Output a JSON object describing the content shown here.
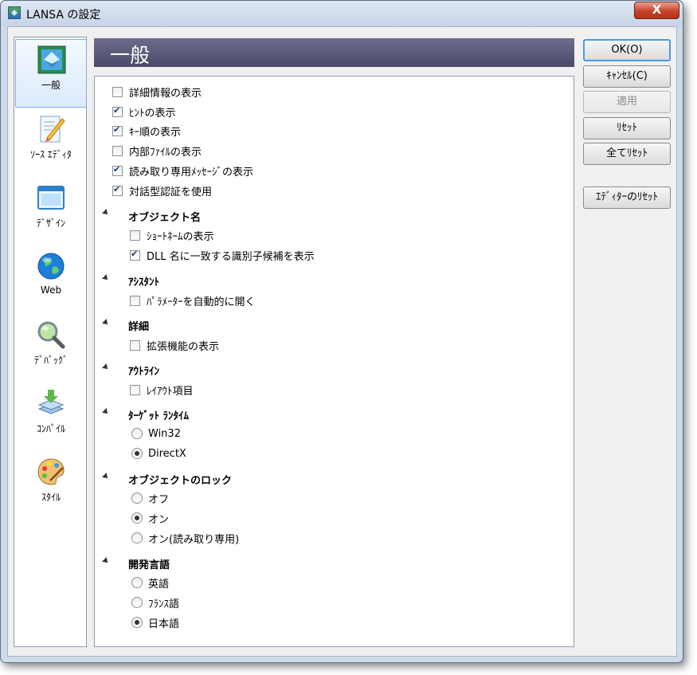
{
  "window": {
    "title": "LANSA の設定",
    "close_label": "X"
  },
  "sidebar": {
    "items": [
      {
        "label": "一般",
        "icon": "general-icon"
      },
      {
        "label": "ｿｰｽ ｴﾃﾞｨﾀ",
        "icon": "source-editor-icon"
      },
      {
        "label": "ﾃﾞｻﾞｲﾝ",
        "icon": "design-icon"
      },
      {
        "label": "Web",
        "icon": "web-globe-icon"
      },
      {
        "label": "ﾃﾞﾊﾞｯｸﾞ",
        "icon": "debug-magnifier-icon"
      },
      {
        "label": "ｺﾝﾊﾟｲﾙ",
        "icon": "compile-icon"
      },
      {
        "label": "ｽﾀｲﾙ",
        "icon": "style-palette-icon"
      }
    ]
  },
  "header": {
    "title": "一般"
  },
  "options": {
    "top": [
      {
        "label": "詳細情報の表示",
        "checked": false
      },
      {
        "label": "ﾋﾝﾄの表示",
        "checked": true
      },
      {
        "label": "ｷｰ順の表示",
        "checked": true
      },
      {
        "label": "内部ﾌｧｲﾙの表示",
        "checked": false
      },
      {
        "label": "読み取り専用ﾒｯｾｰｼﾞの表示",
        "checked": true
      },
      {
        "label": "対話型認証を使用",
        "checked": true
      }
    ],
    "object_name": {
      "title": "オブジェクト名",
      "items": [
        {
          "label": "ｼｮｰﾄﾈｰﾑの表示",
          "checked": false
        },
        {
          "label": "DLL 名に一致する識別子候補を表示",
          "checked": true
        }
      ]
    },
    "assistant": {
      "title": "ｱｼｽﾀﾝﾄ",
      "items": [
        {
          "label": "ﾊﾟﾗﾒｰﾀｰを自動的に開く",
          "checked": false
        }
      ]
    },
    "detail": {
      "title": "詳細",
      "items": [
        {
          "label": "拡張機能の表示",
          "checked": false
        }
      ]
    },
    "outline": {
      "title": "ｱｳﾄﾗｲﾝ",
      "items": [
        {
          "label": "ﾚｲｱｳﾄ項目",
          "checked": false
        }
      ]
    },
    "target_runtime": {
      "title": "ﾀｰｹﾞｯﾄ ﾗﾝﾀｲﾑ",
      "items": [
        {
          "label": "Win32",
          "selected": false
        },
        {
          "label": "DirectX",
          "selected": true
        }
      ]
    },
    "object_lock": {
      "title": "オブジェクトのロック",
      "items": [
        {
          "label": "オフ",
          "selected": false
        },
        {
          "label": "オン",
          "selected": true
        },
        {
          "label": "オン(読み取り専用)",
          "selected": false
        }
      ]
    },
    "language": {
      "title": "開発言語",
      "items": [
        {
          "label": "英語",
          "selected": false
        },
        {
          "label": "ﾌﾗﾝｽ語",
          "selected": false
        },
        {
          "label": "日本語",
          "selected": true
        }
      ]
    }
  },
  "buttons": {
    "ok": "OK(O)",
    "cancel": "ｷｬﾝｾﾙ(C)",
    "apply": "適用",
    "reset": "ﾘｾｯﾄ",
    "reset_all": "全てﾘｾｯﾄ",
    "editor_reset": "ｴﾃﾞｨﾀｰのﾘｾｯﾄ"
  },
  "colors": {
    "header_bg": "#5a5a78",
    "selected_item": "#dcebfc",
    "accent_border": "#4b9be0"
  }
}
